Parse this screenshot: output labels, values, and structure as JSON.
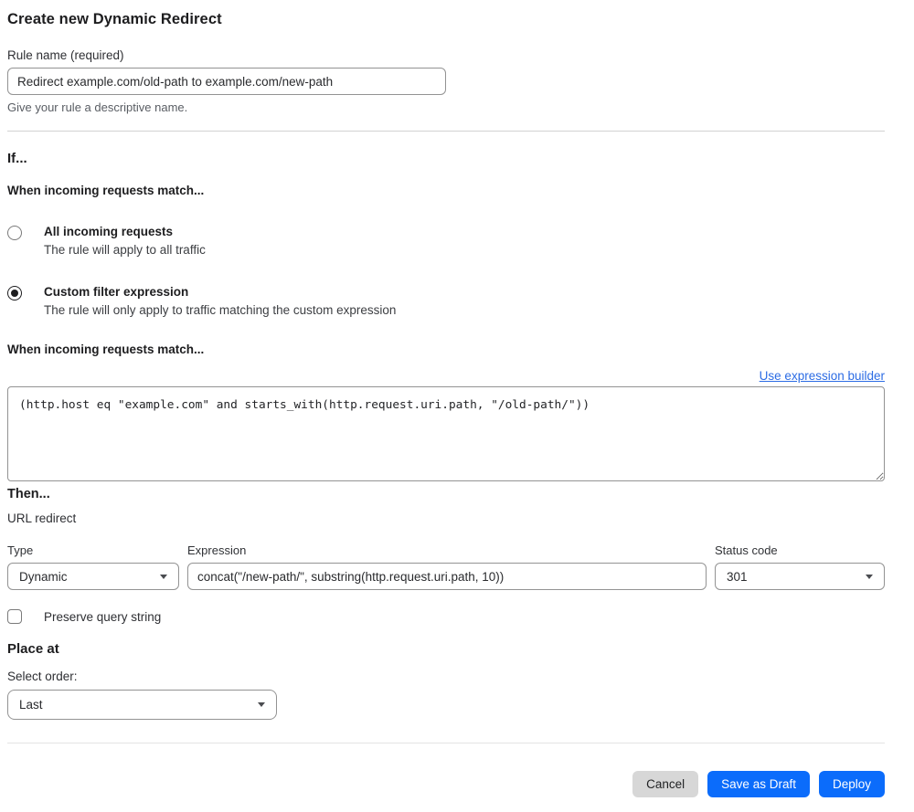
{
  "page": {
    "title": "Create new Dynamic Redirect"
  },
  "rule_name": {
    "label": "Rule name (required)",
    "value": "Redirect example.com/old-path to example.com/new-path",
    "help": "Give your rule a descriptive name."
  },
  "if_section": {
    "heading": "If...",
    "match_heading": "When incoming requests match...",
    "options": [
      {
        "label": "All incoming requests",
        "description": "The rule will apply to all traffic",
        "selected": false
      },
      {
        "label": "Custom filter expression",
        "description": "The rule will only apply to traffic matching the custom expression",
        "selected": true
      }
    ],
    "expression_heading": "When incoming requests match...",
    "builder_link": "Use expression builder",
    "expression_value": "(http.host eq \"example.com\" and starts_with(http.request.uri.path, \"/old-path/\"))"
  },
  "then_section": {
    "heading": "Then...",
    "subheading": "URL redirect",
    "type": {
      "label": "Type",
      "value": "Dynamic"
    },
    "expression": {
      "label": "Expression",
      "value": "concat(\"/new-path/\", substring(http.request.uri.path, 10))"
    },
    "status_code": {
      "label": "Status code",
      "value": "301"
    },
    "preserve": {
      "label": "Preserve query string",
      "checked": false
    }
  },
  "place_at": {
    "heading": "Place at",
    "label": "Select order:",
    "value": "Last"
  },
  "footer": {
    "cancel": "Cancel",
    "save_draft": "Save as Draft",
    "deploy": "Deploy"
  },
  "colors": {
    "accent": "#0b6cfb",
    "link": "#2c6ce4",
    "input_border": "#939393",
    "divider": "#d2d2d2",
    "cancel_bg": "#d7d7d7"
  }
}
